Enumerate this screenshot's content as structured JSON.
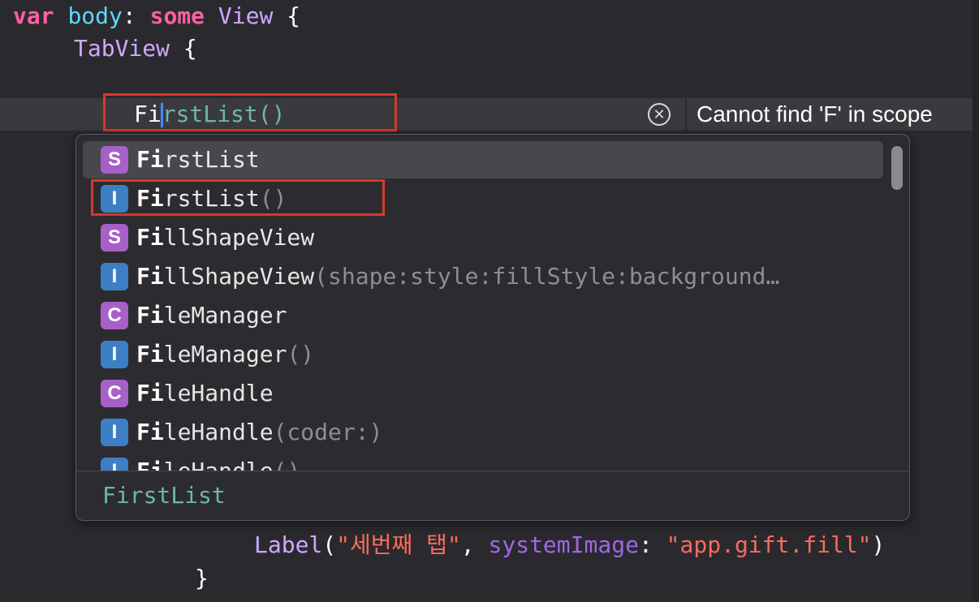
{
  "editor": {
    "line1": {
      "kw_var": "var",
      "name": "body",
      "colon": ": ",
      "kw_some": "some",
      "type": "View",
      "brace": " {"
    },
    "line2": {
      "type": "TabView",
      "brace": " {"
    },
    "line_current": {
      "typed": "Fi",
      "completion": "rstList()"
    },
    "line_label": {
      "fn": "Label",
      "open": "(",
      "str1": "\"세번째 탭\"",
      "comma": ", ",
      "arg": "systemImage",
      "argcolon": ": ",
      "str2": "\"app.gift.fill\"",
      "close": ")"
    },
    "line_close": "}"
  },
  "error": {
    "message": "Cannot find 'F' in scope",
    "icon": "error-x-circle-icon"
  },
  "autocomplete": {
    "items": [
      {
        "kind": "S",
        "match": "Fi",
        "rest": "rstList",
        "params": ""
      },
      {
        "kind": "I",
        "match": "Fi",
        "rest": "rstList",
        "params": "()"
      },
      {
        "kind": "S",
        "match": "Fi",
        "rest": "llShapeView",
        "params": ""
      },
      {
        "kind": "I",
        "match": "Fi",
        "rest": "llShapeView",
        "params": "(shape:style:fillStyle:background…"
      },
      {
        "kind": "C",
        "match": "Fi",
        "rest": "leManager",
        "params": ""
      },
      {
        "kind": "I",
        "match": "Fi",
        "rest": "leManager",
        "params": "()"
      },
      {
        "kind": "C",
        "match": "Fi",
        "rest": "leHandle",
        "params": ""
      },
      {
        "kind": "I",
        "match": "Fi",
        "rest": "leHandle",
        "params": "(coder:)"
      },
      {
        "kind": "I",
        "match": "Fi",
        "rest": "leHandle",
        "params": "()"
      }
    ],
    "detail": "FirstList"
  },
  "colors": {
    "highlight_box": "#d5392c",
    "struct_badge": "#a760c8",
    "init_badge": "#3d7fc4"
  }
}
